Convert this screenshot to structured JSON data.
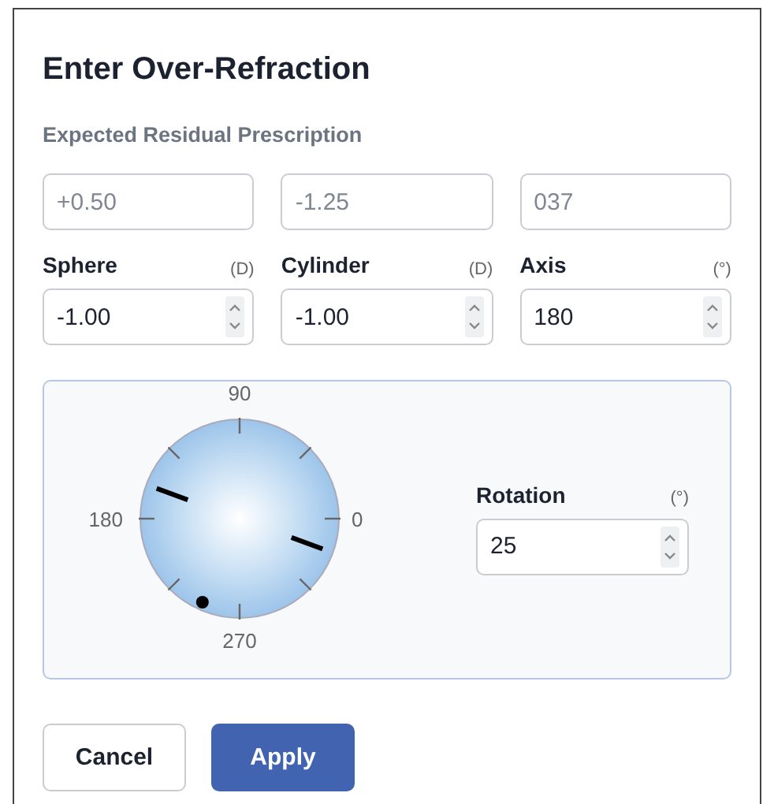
{
  "title": "Enter Over-Refraction",
  "expected": {
    "label": "Expected Residual Prescription",
    "values": [
      "+0.50",
      "-1.25",
      "037"
    ]
  },
  "fields": [
    {
      "label": "Sphere",
      "unit": "(D)",
      "value": "-1.00"
    },
    {
      "label": "Cylinder",
      "unit": "(D)",
      "value": "-1.00"
    },
    {
      "label": "Axis",
      "unit": "(°)",
      "value": "180"
    }
  ],
  "dial": {
    "labels": [
      "90",
      "180",
      "0",
      "270"
    ]
  },
  "rotation": {
    "label": "Rotation",
    "unit": "(°)",
    "value": "25"
  },
  "buttons": [
    {
      "label": "Cancel",
      "kind": "secondary"
    },
    {
      "label": "Apply",
      "kind": "primary"
    }
  ]
}
